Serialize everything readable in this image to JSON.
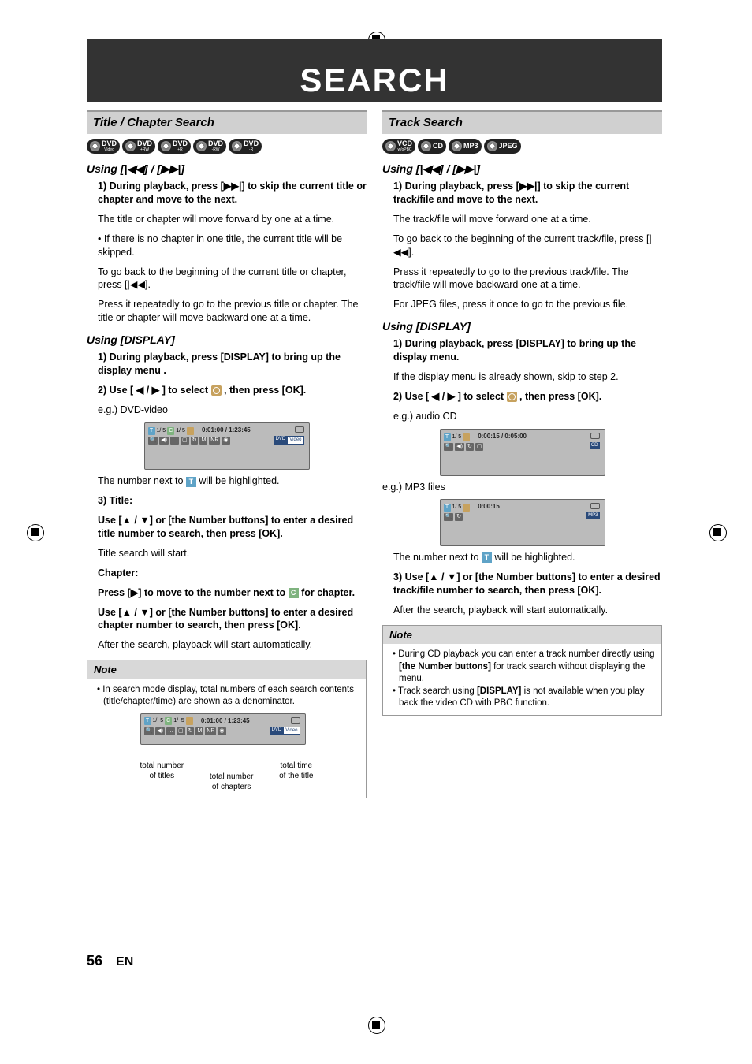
{
  "header": {
    "title": "SEARCH"
  },
  "left": {
    "section_title": "Title / Chapter Search",
    "badges": [
      {
        "main": "DVD",
        "sub": "Video"
      },
      {
        "main": "DVD",
        "sub": "+RW"
      },
      {
        "main": "DVD",
        "sub": "+R"
      },
      {
        "main": "DVD",
        "sub": "-RW"
      },
      {
        "main": "DVD",
        "sub": "-R"
      }
    ],
    "using_skip": "Using [|◀◀] / [▶▶|]",
    "step1_bold": "1) During playback, press [▶▶|] to skip the current title or chapter and move to the next.",
    "step1_p1": "The title or chapter will move forward by one at a time.",
    "step1_p2": "• If there is no chapter in one title, the current title will be skipped.",
    "step1_p3": "To go back to the beginning of the current title or chapter, press [|◀◀].",
    "step1_p4": "Press it repeatedly to go to the previous title or chapter. The title or chapter will move backward one at a time.",
    "using_display": "Using [DISPLAY]",
    "d_step1": "1) During playback, press [DISPLAY] to bring up the display menu .",
    "d_step2_a": "2) Use [ ◀ / ▶ ] to select ",
    "d_step2_b": " , then press [OK].",
    "eg_dvd": "e.g.) DVD-video",
    "osd1_time": "0:01:00 / 1:23:45",
    "osd1_t": "1/   5",
    "osd1_c": "1/   5",
    "num_next_a": "The number next to ",
    "num_next_b": " will be highlighted.",
    "step3_bold": "3) Title:",
    "step3_p1": "Use [▲ / ▼] or [the Number buttons] to enter a desired title number to search, then press [OK].",
    "step3_p2": "Title search will start.",
    "chapter_bold": "Chapter:",
    "chapter_p1a": "Press [▶] to move to the number next to ",
    "chapter_p1b": " for chapter.",
    "chapter_p2": "Use [▲ / ▼] or [the Number buttons] to enter a desired chapter number to search, then press [OK].",
    "chapter_p3": "After the search, playback will start automatically.",
    "note_head": "Note",
    "note_item": "In search mode display, total numbers of each search contents (title/chapter/time) are shown as a denominator.",
    "annot": {
      "titles": "total number\nof titles",
      "chapters": "total number\nof chapters",
      "time": "total time\nof the title"
    }
  },
  "right": {
    "section_title": "Track Search",
    "badges": [
      {
        "main": "VCD",
        "sub": "w/oPBC"
      },
      {
        "main": "CD",
        "sub": ""
      },
      {
        "main": "MP3",
        "sub": ""
      },
      {
        "main": "JPEG",
        "sub": ""
      }
    ],
    "using_skip": "Using [|◀◀] / [▶▶|]",
    "step1_bold": "1) During playback, press [▶▶|] to skip the current track/file and move to the next.",
    "step1_p1": "The track/file will move forward one at a time.",
    "step1_p2": "To go back to the beginning of the current track/file, press [|◀◀].",
    "step1_p3": "Press it repeatedly to go to the previous track/file. The track/file will move backward one at a time.",
    "step1_p4": "For JPEG files, press it once to go to the previous file.",
    "using_display": "Using [DISPLAY]",
    "d_step1": "1) During playback, press [DISPLAY] to bring up the display menu.",
    "d_step1_p": "If the display menu is already shown, skip to step 2.",
    "d_step2_a": "2) Use [ ◀ / ▶ ] to select ",
    "d_step2_b": " , then press [OK].",
    "eg_cd": "e.g.) audio CD",
    "osd_cd_t": "1/   5",
    "osd_cd_time": "0:00:15 / 0:05:00",
    "osd_cd_label": "CD",
    "eg_mp3": "e.g.) MP3 files",
    "osd_mp3_t": "1/   5",
    "osd_mp3_time": "0:00:15",
    "osd_mp3_label": "MP3",
    "num_next_a": "The number next to ",
    "num_next_b": " will be highlighted.",
    "step3_bold": "3) Use [▲ / ▼] or [the Number buttons] to enter a desired track/file number to search, then press [OK].",
    "step3_p": "After the search, playback will start automatically.",
    "note_head": "Note",
    "note1": "During CD playback you can enter a track number directly using [the Number buttons] for track search without displaying the menu.",
    "note2": "Track search using [DISPLAY] is not available when you play back the video CD with PBC function."
  },
  "footer": {
    "page": "56",
    "lang": "EN"
  }
}
